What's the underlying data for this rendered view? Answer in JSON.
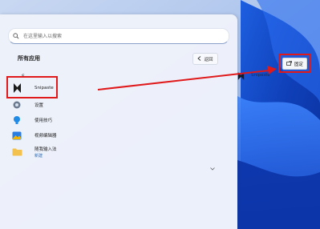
{
  "search": {
    "placeholder": "在这里输入以搜索"
  },
  "all_apps": {
    "title": "所有应用",
    "back_label": "返回"
  },
  "group_letter": "S",
  "apps": [
    {
      "label": "Snipaste",
      "icon": "snipaste-icon"
    },
    {
      "label": "设置",
      "icon": "gear-icon"
    },
    {
      "label": "使用技巧",
      "icon": "tips-icon"
    },
    {
      "label": "视频编辑器",
      "icon": "photos-icon"
    },
    {
      "label": "随我输入法",
      "sublabel": "新建",
      "icon": "folder-icon"
    }
  ],
  "dragged_tile": {
    "label": "Snipaste"
  },
  "pin_tooltip": {
    "label": "固定"
  },
  "colors": {
    "highlight": "#e0191b",
    "arrow": "#e0191b",
    "accent": "#2b6cb8"
  }
}
